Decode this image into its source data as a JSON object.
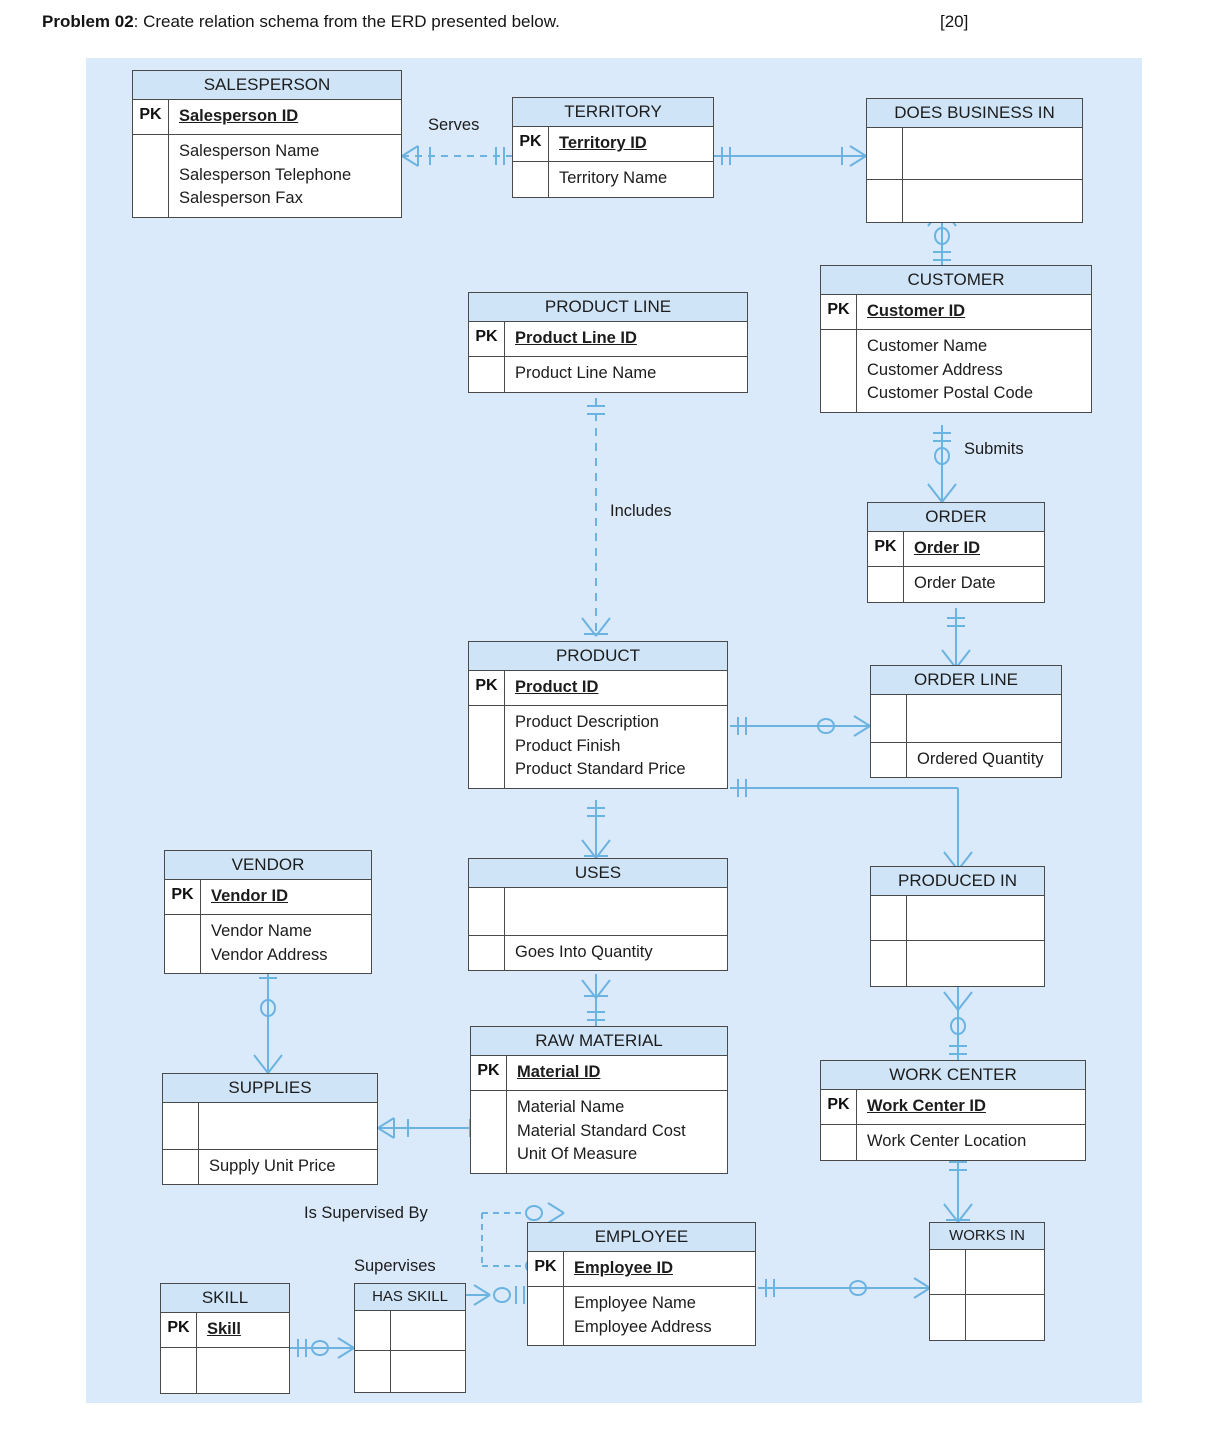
{
  "problem": {
    "label": "Problem 02",
    "text": ": Create relation schema from the ERD presented below.",
    "marks": "[20]"
  },
  "diagram": {
    "background_color": "#daeafa",
    "entity_header_color": "#cfe4f7",
    "line_color": "#6bb3e0",
    "border_color": "#4a4a4a",
    "entities": [
      {
        "id": "salesperson",
        "title": "SALESPERSON",
        "pk_marker": "PK",
        "pk_attribute": "Salesperson ID",
        "attributes": [
          "Salesperson Name",
          "Salesperson Telephone",
          "Salesperson Fax"
        ]
      },
      {
        "id": "territory",
        "title": "TERRITORY",
        "pk_marker": "PK",
        "pk_attribute": "Territory ID",
        "attributes": [
          "Territory Name"
        ]
      },
      {
        "id": "does_business_in",
        "title": "DOES BUSINESS IN",
        "pk_marker": "",
        "pk_attribute": "",
        "attributes": []
      },
      {
        "id": "customer",
        "title": "CUSTOMER",
        "pk_marker": "PK",
        "pk_attribute": "Customer ID",
        "attributes": [
          "Customer Name",
          "Customer Address",
          "Customer Postal Code"
        ]
      },
      {
        "id": "product_line",
        "title": "PRODUCT LINE",
        "pk_marker": "PK",
        "pk_attribute": "Product Line ID",
        "attributes": [
          "Product Line Name"
        ]
      },
      {
        "id": "order",
        "title": "ORDER",
        "pk_marker": "PK",
        "pk_attribute": "Order ID",
        "attributes": [
          "Order Date"
        ]
      },
      {
        "id": "product",
        "title": "PRODUCT",
        "pk_marker": "PK",
        "pk_attribute": "Product ID",
        "attributes": [
          "Product Description",
          "Product Finish",
          "Product Standard Price"
        ]
      },
      {
        "id": "order_line",
        "title": "ORDER LINE",
        "pk_marker": "",
        "pk_attribute": "",
        "attributes": [
          "Ordered Quantity"
        ]
      },
      {
        "id": "vendor",
        "title": "VENDOR",
        "pk_marker": "PK",
        "pk_attribute": "Vendor ID",
        "attributes": [
          "Vendor Name",
          "Vendor Address"
        ]
      },
      {
        "id": "uses",
        "title": "USES",
        "pk_marker": "",
        "pk_attribute": "",
        "attributes": [
          "Goes Into Quantity"
        ]
      },
      {
        "id": "produced_in",
        "title": "PRODUCED IN",
        "pk_marker": "",
        "pk_attribute": "",
        "attributes": []
      },
      {
        "id": "supplies",
        "title": "SUPPLIES",
        "pk_marker": "",
        "pk_attribute": "",
        "attributes": [
          "Supply Unit Price"
        ]
      },
      {
        "id": "raw_material",
        "title": "RAW MATERIAL",
        "pk_marker": "PK",
        "pk_attribute": "Material ID",
        "attributes": [
          "Material Name",
          "Material Standard Cost",
          "Unit Of Measure"
        ]
      },
      {
        "id": "work_center",
        "title": "WORK CENTER",
        "pk_marker": "PK",
        "pk_attribute": "Work Center ID",
        "attributes": [
          "Work Center Location"
        ]
      },
      {
        "id": "employee",
        "title": "EMPLOYEE",
        "pk_marker": "PK",
        "pk_attribute": "Employee ID",
        "attributes": [
          "Employee Name",
          "Employee Address"
        ]
      },
      {
        "id": "works_in",
        "title": "WORKS IN",
        "pk_marker": "",
        "pk_attribute": "",
        "attributes": []
      },
      {
        "id": "skill",
        "title": "SKILL",
        "pk_marker": "PK",
        "pk_attribute": "Skill",
        "attributes": []
      },
      {
        "id": "has_skill",
        "title": "HAS SKILL",
        "pk_marker": "",
        "pk_attribute": "",
        "attributes": []
      }
    ],
    "relationship_labels": [
      {
        "id": "serves",
        "text": "Serves"
      },
      {
        "id": "submits",
        "text": "Submits"
      },
      {
        "id": "includes",
        "text": "Includes"
      },
      {
        "id": "is_supervised_by",
        "text": "Is Supervised By"
      },
      {
        "id": "supervises",
        "text": "Supervises"
      }
    ]
  }
}
